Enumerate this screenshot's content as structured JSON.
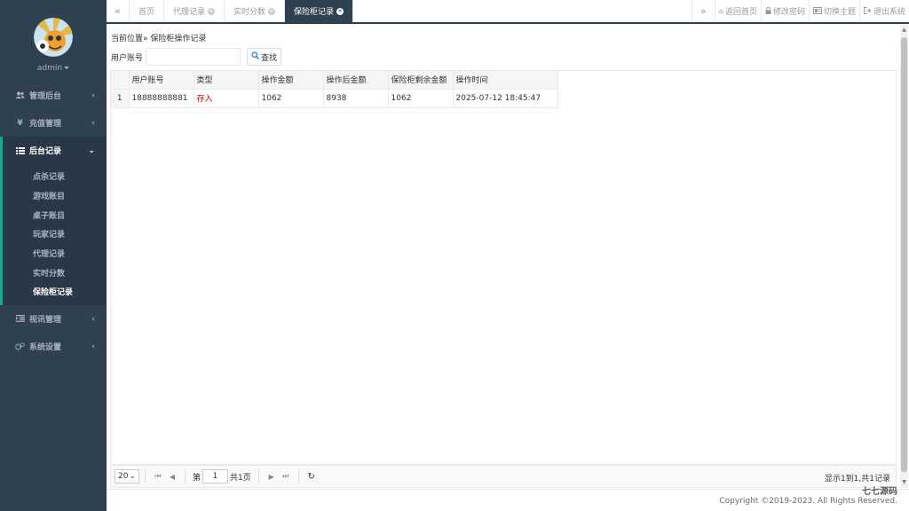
{
  "sidebar": {
    "user": "admin",
    "menus": [
      {
        "label": "管理后台",
        "icon": "users-icon"
      },
      {
        "label": "充值管理",
        "icon": "yen-icon"
      },
      {
        "label": "后台记录",
        "icon": "list-icon"
      },
      {
        "label": "视讯管理",
        "icon": "indent-icon"
      },
      {
        "label": "系统设置",
        "icon": "gears-icon"
      }
    ],
    "submenu": [
      "点杀记录",
      "游戏账目",
      "桌子账目",
      "玩家记录",
      "代理记录",
      "实时分数",
      "保险柜记录"
    ]
  },
  "tabs": {
    "nav_left": "«",
    "nav_right": "»",
    "items": [
      "首页",
      "代理记录",
      "实时分数",
      "保险柜记录"
    ],
    "tools": [
      "返回首页",
      "修改密码",
      "切换主题",
      "退出系统"
    ]
  },
  "content": {
    "breadcrumb": "当前位置» 保险柜操作记录",
    "search_label": "用户账号",
    "search_value": "",
    "search_button": "查找",
    "columns": [
      "用户账号",
      "类型",
      "操作金额",
      "操作后金额",
      "保险柜剩余金额",
      "操作时间"
    ],
    "rows": [
      {
        "num": "1",
        "account": "18888888881",
        "type": "存入",
        "amount": "1062",
        "after": "8938",
        "remaining": "1062",
        "time": "2025-07-12 18:45:47"
      }
    ]
  },
  "pager": {
    "page_size": "20",
    "page_prefix": "第",
    "page_value": "1",
    "page_suffix": "共1页",
    "info": "显示1到1,共1记录"
  },
  "footer": {
    "copyright": "Copyright ©2019-2023. All Rights Reserved.",
    "watermark": "七七源码"
  },
  "colors": {
    "sidebar": "#2f4050",
    "accent": "#19aa8d",
    "danger": "#e60000"
  }
}
